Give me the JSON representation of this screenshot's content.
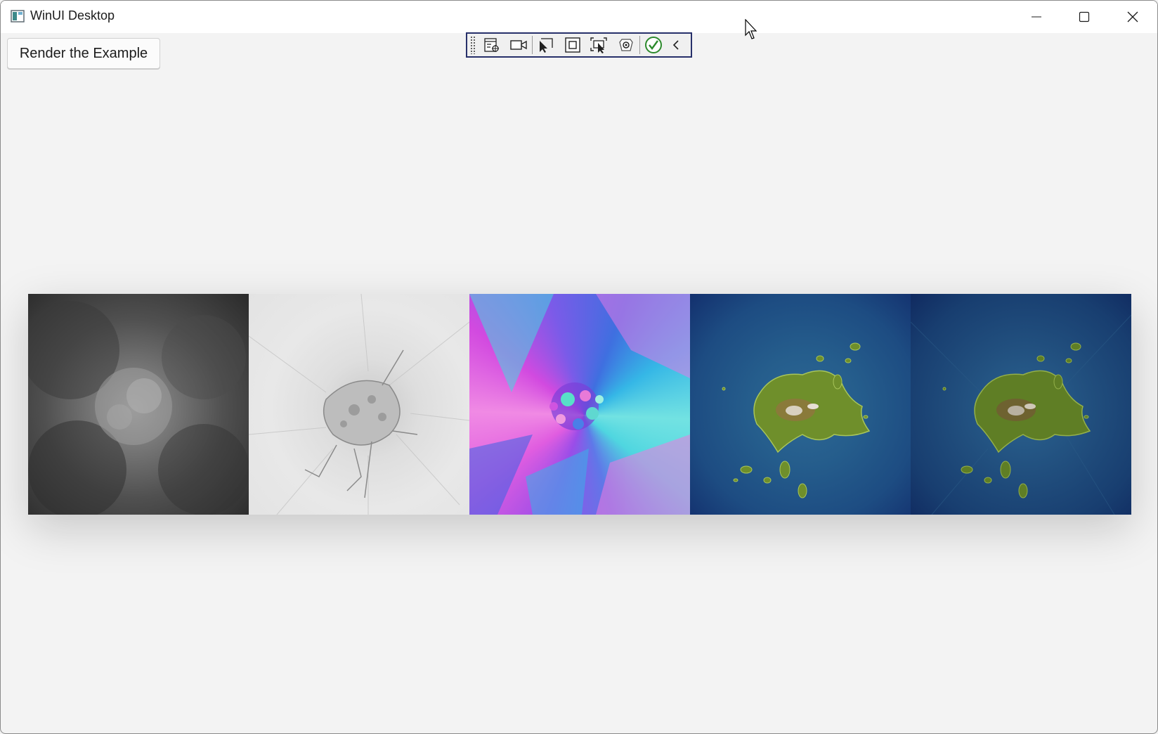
{
  "window": {
    "title": "WinUI Desktop"
  },
  "caption_buttons": {
    "minimize_icon": "minimize-icon",
    "maximize_icon": "maximize-icon",
    "close_icon": "close-icon"
  },
  "main": {
    "render_button_label": "Render the Example"
  },
  "dev_toolbar": {
    "tools": [
      "go-to-live-visual-tree-icon",
      "select-element-camera-icon",
      "select-element-icon",
      "display-layout-adorners-icon",
      "track-focus-icon",
      "hot-reload-icon",
      "binding-failures-check-icon",
      "collapse-toolbar-icon"
    ]
  },
  "image_strip": {
    "panels": [
      "heightmap-panel",
      "slope-map-panel",
      "normal-map-panel",
      "terrain-color-panel",
      "terrain-shaded-panel"
    ]
  },
  "colors": {
    "window_bg": "#f3f3f3",
    "titlebar_bg": "#ffffff",
    "toolbar_border": "#27306a",
    "ocean_blue": "#1d4c82",
    "land_green": "#6f8f2b"
  }
}
